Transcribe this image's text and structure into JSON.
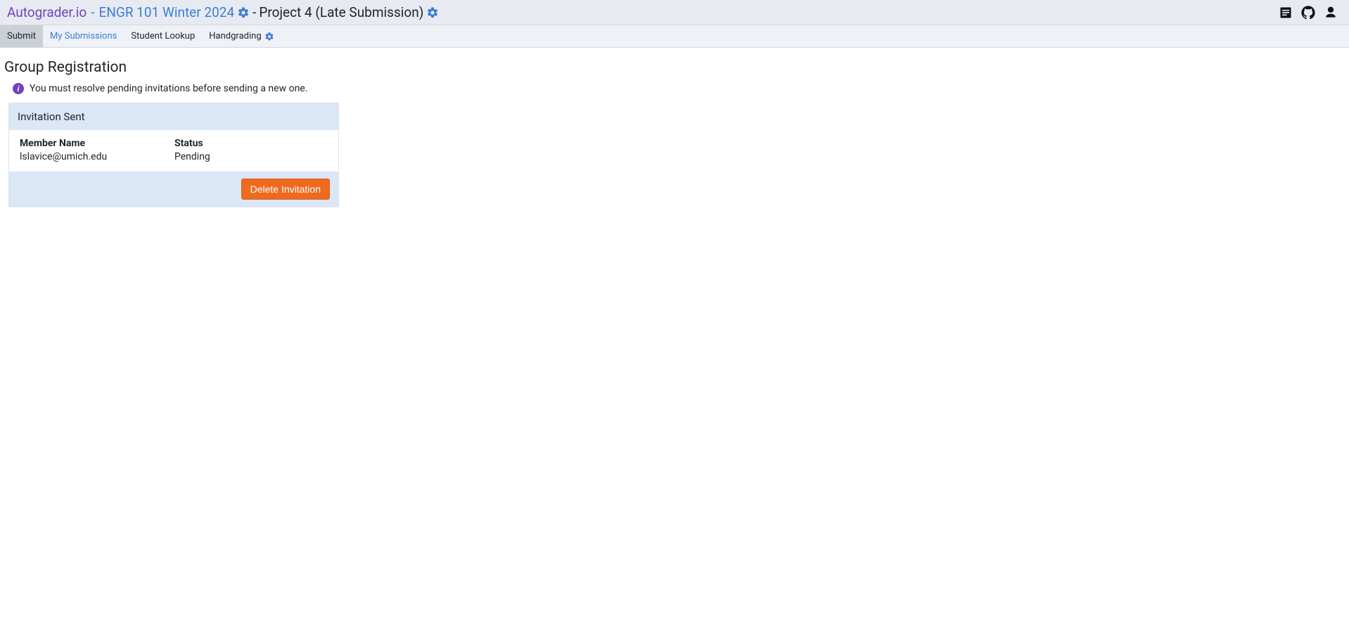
{
  "header": {
    "site_name": "Autograder.io",
    "sep1": " - ",
    "course_name": "ENGR 101 Winter 2024",
    "sep2": " - ",
    "project_name": "Project 4 (Late Submission)"
  },
  "tabs": {
    "submit": "Submit",
    "my_submissions": "My Submissions",
    "student_lookup": "Student Lookup",
    "handgrading": "Handgrading"
  },
  "page": {
    "title": "Group Registration",
    "info_message": "You must resolve pending invitations before sending a new one."
  },
  "invitation": {
    "card_title": "Invitation Sent",
    "columns": {
      "name": "Member Name",
      "status": "Status"
    },
    "rows": [
      {
        "name": "lslavice@umich.edu",
        "status": "Pending"
      }
    ],
    "delete_label": "Delete Invitation"
  }
}
